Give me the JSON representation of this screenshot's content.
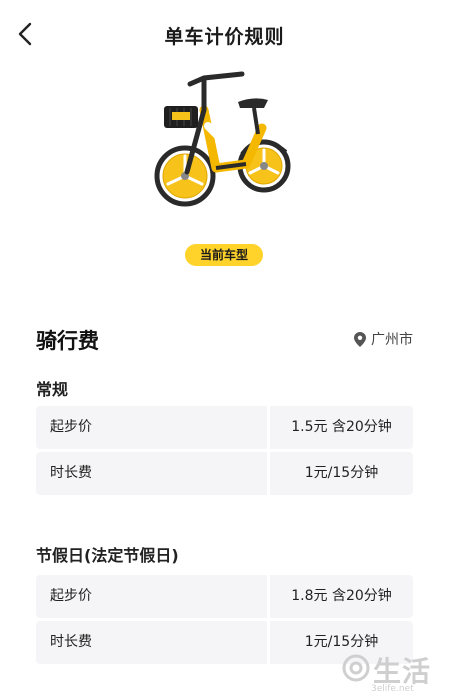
{
  "header": {
    "title": "单车计价规则",
    "back_icon": "chevron-left-icon"
  },
  "bike": {
    "badge": "当前车型",
    "accent_color": "#f5b800"
  },
  "riding_fee": {
    "title": "骑行费",
    "location_icon": "map-pin-icon",
    "location": "广州市"
  },
  "groups": [
    {
      "title": "常规",
      "rows": [
        {
          "label": "起步价",
          "value": "1.5元 含20分钟"
        },
        {
          "label": "时长费",
          "value": "1元/15分钟"
        }
      ]
    },
    {
      "title": "节假日(法定节假日)",
      "rows": [
        {
          "label": "起步价",
          "value": "1.8元 含20分钟"
        },
        {
          "label": "时长费",
          "value": "1元/15分钟"
        }
      ]
    }
  ],
  "watermark": {
    "text": "生活",
    "url": "3elife.net"
  }
}
